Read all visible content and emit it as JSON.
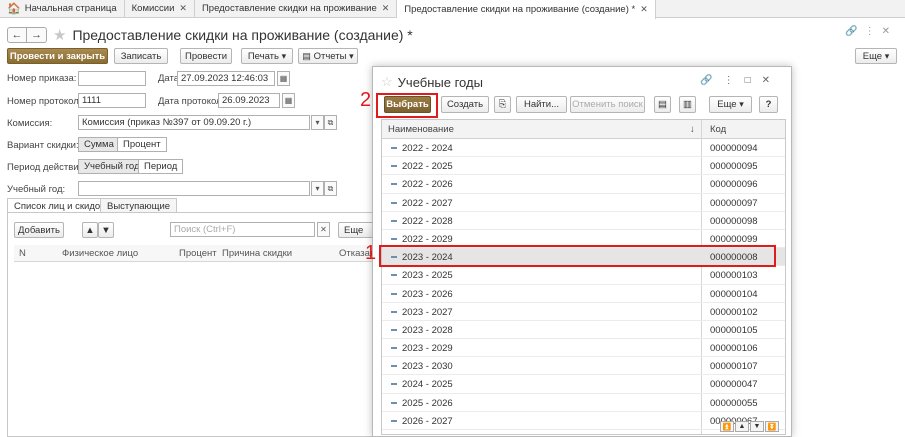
{
  "tabs": [
    {
      "label": "Начальная страница",
      "closable": false
    },
    {
      "label": "Комиссии",
      "closable": true
    },
    {
      "label": "Предоставление скидки на проживание",
      "closable": true
    },
    {
      "label": "Предоставление скидки на проживание (создание) *",
      "closable": true,
      "active": true
    }
  ],
  "form": {
    "title": "Предоставление скидки на проживание (создание) *",
    "toolbar": {
      "post_close": "Провести и закрыть",
      "save": "Записать",
      "post": "Провести",
      "print": "Печать",
      "reports": "Отчеты",
      "more": "Еще"
    },
    "fields": {
      "order_no_label": "Номер приказа:",
      "order_no": "",
      "date_label": "Дата:",
      "date": "27.09.2023 12:46:03",
      "protocol_no_label": "Номер протокола:",
      "protocol_no": "1111",
      "protocol_date_label": "Дата протокола:",
      "protocol_date": "26.09.2023",
      "commission_label": "Комиссия:",
      "commission": "Комиссия (приказ №397 от 09.09.20 г.)",
      "discount_variant_label": "Вариант скидки:",
      "variant_sum": "Сумма",
      "variant_percent": "Процент",
      "period_label": "Период действия:",
      "period_year": "Учебный год",
      "period_period": "Период",
      "school_year_label": "Учебный год:",
      "school_year": ""
    },
    "list_tabs": [
      "Список лиц и скидок",
      "Выступающие"
    ],
    "list_toolbar": {
      "add": "Добавить",
      "search_placeholder": "Поиск (Ctrl+F)",
      "more": "Еще"
    },
    "list_columns": [
      "N",
      "Физическое лицо",
      "Процент",
      "Причина скидки",
      "Отказать"
    ]
  },
  "modal": {
    "title": "Учебные годы",
    "toolbar": {
      "select": "Выбрать",
      "create": "Создать",
      "find": "Найти...",
      "cancel_search": "Отменить поиск",
      "more": "Еще",
      "help": "?"
    },
    "columns": {
      "name": "Наименование",
      "code": "Код"
    },
    "rows": [
      {
        "name": "2022 - 2024",
        "code": "000000094"
      },
      {
        "name": "2022 - 2025",
        "code": "000000095"
      },
      {
        "name": "2022 - 2026",
        "code": "000000096"
      },
      {
        "name": "2022 - 2027",
        "code": "000000097"
      },
      {
        "name": "2022 - 2028",
        "code": "000000098"
      },
      {
        "name": "2022 - 2029",
        "code": "000000099"
      },
      {
        "name": "2023 - 2024",
        "code": "000000008",
        "selected": true
      },
      {
        "name": "2023 - 2025",
        "code": "000000103"
      },
      {
        "name": "2023 - 2026",
        "code": "000000104"
      },
      {
        "name": "2023 - 2027",
        "code": "000000102"
      },
      {
        "name": "2023 - 2028",
        "code": "000000105"
      },
      {
        "name": "2023 - 2029",
        "code": "000000106"
      },
      {
        "name": "2023 - 2030",
        "code": "000000107"
      },
      {
        "name": "2024 - 2025",
        "code": "000000047"
      },
      {
        "name": "2025 - 2026",
        "code": "000000055"
      },
      {
        "name": "2026 - 2027",
        "code": "000000067"
      }
    ]
  },
  "annotations": {
    "step1": "1",
    "step2": "2"
  },
  "colors": {
    "accent_button": "#8a6d33",
    "highlight": "#e01b1b",
    "row_selected": "#e5e5e5"
  }
}
